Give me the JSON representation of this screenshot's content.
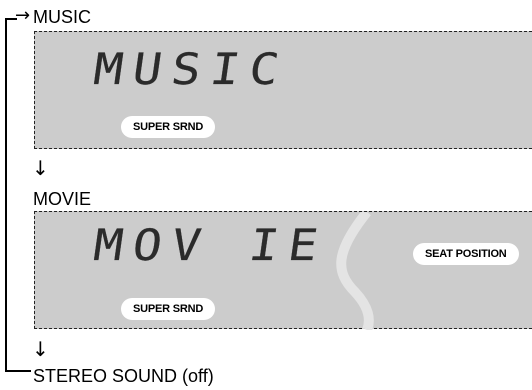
{
  "flow": {
    "item1_label": "MUSIC",
    "item2_label": "MOVIE",
    "item3_label": "STEREO SOUND (off)",
    "arrow_right": "→",
    "arrow_down": "↓"
  },
  "panel_music": {
    "segment_text": "MUSIC",
    "badge_label": "SUPER SRND"
  },
  "panel_movie": {
    "segment_text": "MOV IE",
    "badge_label": "SUPER SRND",
    "seat_label": "SEAT POSITION"
  },
  "colors": {
    "panel_bg": "#cccccc",
    "curve": "#e4e4e4",
    "text": "#000000"
  }
}
